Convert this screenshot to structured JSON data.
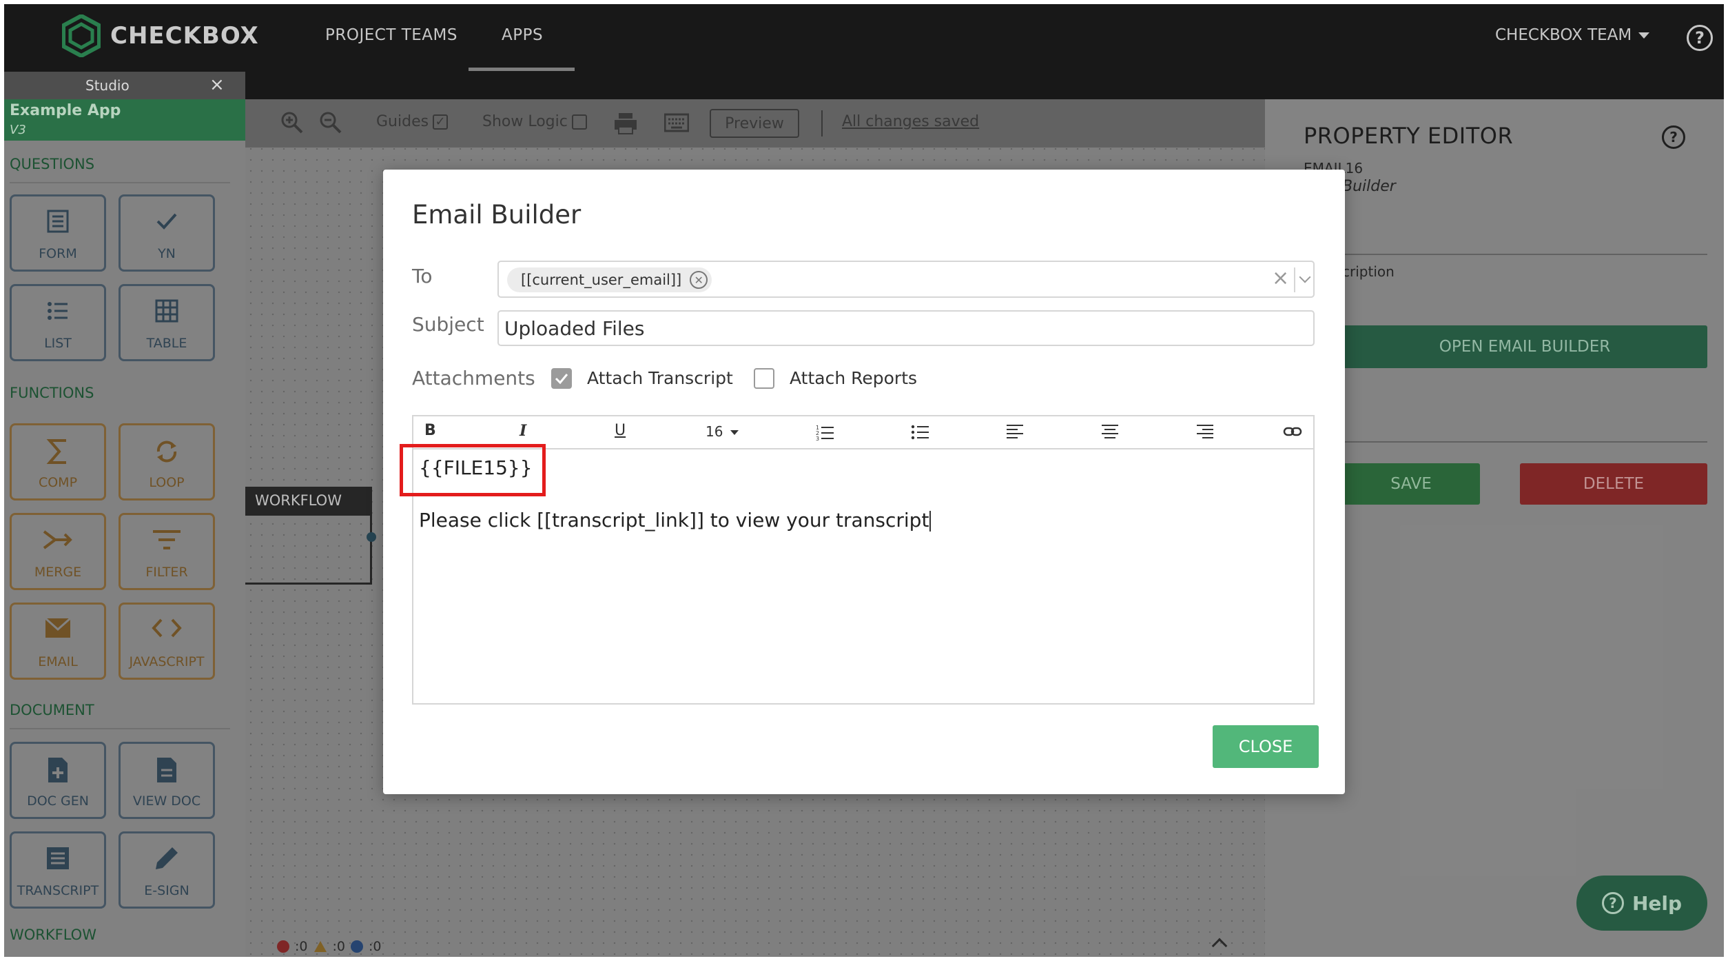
{
  "nav": {
    "brand": "CHECKBOX",
    "tabs": [
      "PROJECT TEAMS",
      "APPS"
    ],
    "team": "CHECKBOX TEAM",
    "help": "?"
  },
  "studio": {
    "tab_label": "Studio",
    "close": "×"
  },
  "app": {
    "name": "Example App",
    "version": "V3"
  },
  "sidebar": {
    "sections": [
      "QUESTIONS",
      "FUNCTIONS",
      "DOCUMENT",
      "WORKFLOW"
    ],
    "tiles": [
      {
        "label": "FORM",
        "icon": "form-icon"
      },
      {
        "label": "YN",
        "icon": "check-icon"
      },
      {
        "label": "LIST",
        "icon": "list-icon"
      },
      {
        "label": "TABLE",
        "icon": "table-icon"
      },
      {
        "label": "COMP",
        "icon": "sigma-icon"
      },
      {
        "label": "LOOP",
        "icon": "loop-icon"
      },
      {
        "label": "MERGE",
        "icon": "merge-icon"
      },
      {
        "label": "FILTER",
        "icon": "filter-icon"
      },
      {
        "label": "EMAIL",
        "icon": "envelope-icon"
      },
      {
        "label": "JAVASCRIPT",
        "icon": "code-icon"
      },
      {
        "label": "DOC GEN",
        "icon": "doc-plus-icon"
      },
      {
        "label": "VIEW DOC",
        "icon": "doc-icon"
      },
      {
        "label": "TRANSCRIPT",
        "icon": "transcript-icon"
      },
      {
        "label": "E-SIGN",
        "icon": "pen-icon"
      }
    ]
  },
  "toolbar": {
    "guides": "Guides",
    "show_logic": "Show Logic",
    "preview": "Preview",
    "status": "All changes saved"
  },
  "canvas": {
    "workflow_label": "WORKFLOW",
    "errors": ":0",
    "warnings": ":0",
    "infos": ":0"
  },
  "property_editor": {
    "title": "PROPERTY EDITOR",
    "id": "EMAIL16",
    "type": "Builder",
    "description_label": "cription",
    "open_button": "OPEN EMAIL BUILDER",
    "save": "SAVE",
    "delete": "DELETE",
    "help": "Help"
  },
  "modal": {
    "title": "Email Builder",
    "to_label": "To",
    "to_chip": "[[current_user_email]]",
    "subject_label": "Subject",
    "subject_value": "Uploaded Files",
    "attachments_label": "Attachments",
    "attach_transcript": "Attach Transcript",
    "attach_transcript_checked": true,
    "attach_reports": "Attach Reports",
    "attach_reports_checked": false,
    "editor_toolbar": {
      "bold": "B",
      "italic": "I",
      "underline": "U",
      "font_size": "16"
    },
    "body_line1": "{{FILE15}}",
    "body_line2": "Please click [[transcript_link]] to view your transcript",
    "close": "CLOSE"
  },
  "colors": {
    "brand_green": "#2e7a4e",
    "close_green": "#52b77a",
    "delete_red": "#8a2a2a",
    "highlight_red": "#e31c1c"
  }
}
